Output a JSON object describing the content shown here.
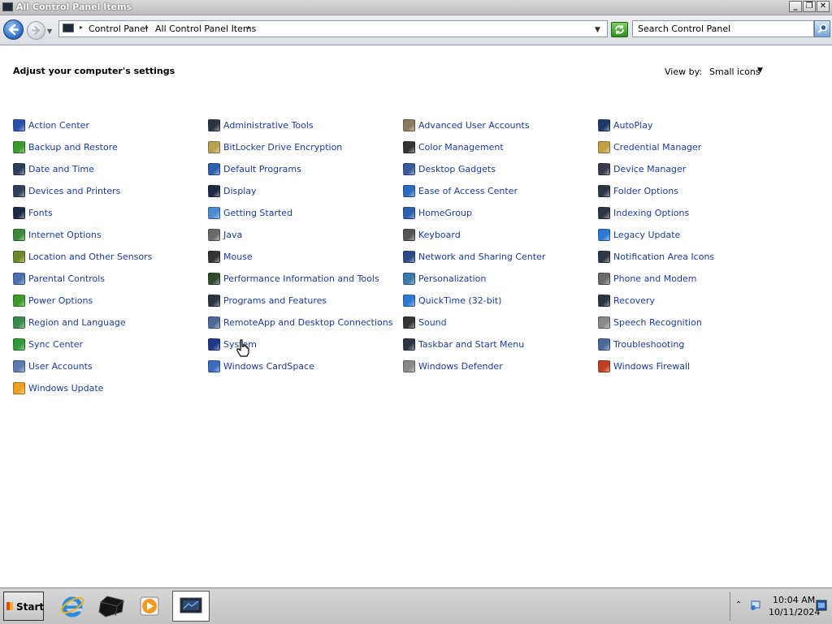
{
  "window": {
    "title": "All Control Panel Items"
  },
  "address": {
    "crumbs": [
      "Control Panel",
      "All Control Panel Items"
    ]
  },
  "search": {
    "placeholder": "Search Control Panel"
  },
  "content": {
    "heading": "Adjust your computer's settings",
    "view_by_label": "View by:",
    "view_by_value": "Small icons"
  },
  "items": [
    [
      "Action Center",
      "Backup and Restore",
      "Date and Time",
      "Devices and Printers",
      "Fonts",
      "Internet Options",
      "Location and Other Sensors",
      "Parental Controls",
      "Power Options",
      "Region and Language",
      "Sync Center",
      "User Accounts",
      "Windows Update"
    ],
    [
      "Administrative Tools",
      "BitLocker Drive Encryption",
      "Default Programs",
      "Display",
      "Getting Started",
      "Java",
      "Mouse",
      "Performance Information and Tools",
      "Programs and Features",
      "RemoteApp and Desktop Connections",
      "System",
      "Windows CardSpace"
    ],
    [
      "Advanced User Accounts",
      "Color Management",
      "Desktop Gadgets",
      "Ease of Access Center",
      "HomeGroup",
      "Keyboard",
      "Network and Sharing Center",
      "Personalization",
      "QuickTime (32-bit)",
      "Sound",
      "Taskbar and Start Menu",
      "Windows Defender"
    ],
    [
      "AutoPlay",
      "Credential Manager",
      "Device Manager",
      "Folder Options",
      "Indexing Options",
      "Legacy Update",
      "Notification Area Icons",
      "Phone and Modem",
      "Recovery",
      "Speech Recognition",
      "Troubleshooting",
      "Windows Firewall"
    ]
  ],
  "item_icon_colors": [
    [
      "#2b4fb0",
      "#3a9a2a",
      "#2d3f5a",
      "#2d3f5a",
      "#1d2a44",
      "#3b8a3a",
      "#6a8a2a",
      "#4a6fb0",
      "#3a9a2a",
      "#3a8a4a",
      "#2e9a3a",
      "#5a7ab0",
      "#f0a020"
    ],
    [
      "#2d3544",
      "#b8a050",
      "#2c5fb0",
      "#1d2a44",
      "#4a8ad0",
      "#6a6a6a",
      "#333333",
      "#2a4a2a",
      "#2d3544",
      "#4a6a9a",
      "#1d3a8a",
      "#3a6ac0"
    ],
    [
      "#8a7a5a",
      "#333333",
      "#3a5aa0",
      "#2b6ac0",
      "#2b5fb0",
      "#555555",
      "#2a4a8a",
      "#3a7ab0",
      "#2b7ad0",
      "#333333",
      "#2d3544",
      "#888888"
    ],
    [
      "#1d3a6a",
      "#c0a040",
      "#3a3a4a",
      "#2d3544",
      "#2d3544",
      "#2b7ad0",
      "#2d3544",
      "#6a6a6a",
      "#2d3544",
      "#888888",
      "#4a6a9a",
      "#c04020"
    ]
  ],
  "taskbar": {
    "start_label": "Start",
    "apps": [
      "internet-explorer-icon",
      "storage-device-icon",
      "media-player-icon",
      "control-panel-icon"
    ],
    "clock_time": "10:04 AM",
    "clock_date": "10/11/2024"
  }
}
